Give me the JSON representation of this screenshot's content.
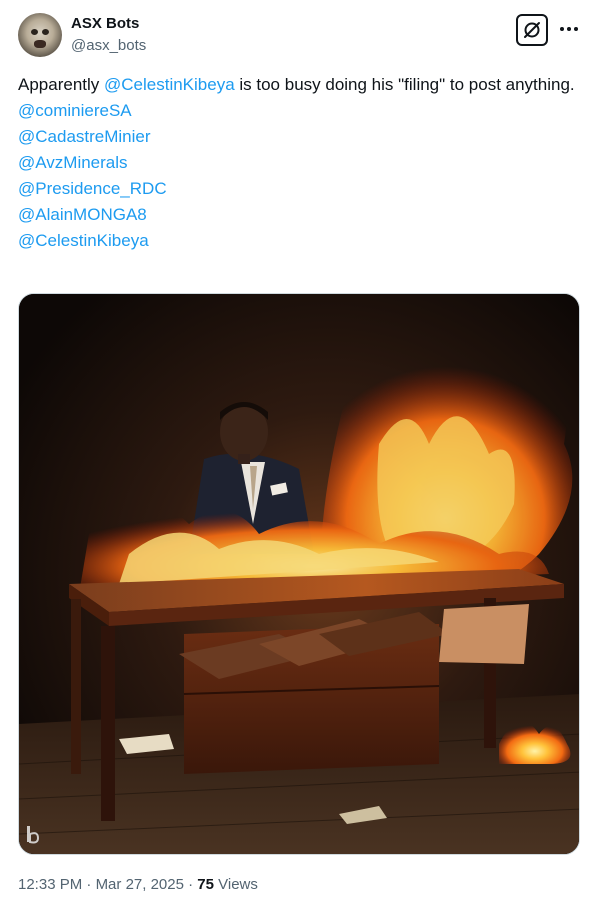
{
  "author": {
    "name": "ASX Bots",
    "handle": "@asx_bots",
    "avatar_icon": "avatar-face"
  },
  "tweet": {
    "line1_prefix": "Apparently ",
    "line1_mention": "@CelestinKibeya",
    "line1_suffix": " is too busy doing his \"filing\" to post anything.",
    "mentions": [
      "@cominiereSA",
      "@CadastreMinier",
      "@AvzMinerals",
      "@Presidence_RDC",
      "@AlainMONGA8",
      "@CelestinKibeya"
    ]
  },
  "media": {
    "watermark": "b"
  },
  "meta": {
    "time": "12:33 PM",
    "separator": " · ",
    "date": "Mar 27, 2025",
    "views_count": "75",
    "views_label": " Views"
  },
  "colors": {
    "link": "#1d9bf0",
    "secondary_text": "#536471",
    "primary_text": "#0f1419"
  }
}
